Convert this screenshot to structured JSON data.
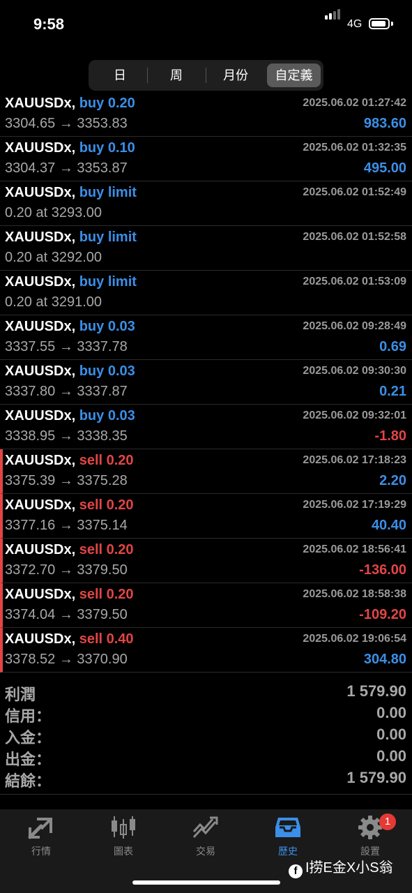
{
  "status": {
    "time": "9:58",
    "network": "4G",
    "battery_level": 0.9
  },
  "segments": [
    {
      "label": "日",
      "active": false
    },
    {
      "label": "周",
      "active": false
    },
    {
      "label": "月份",
      "active": false
    },
    {
      "label": "自定義",
      "active": true
    }
  ],
  "trades": [
    {
      "symbol": "XAUUSDx,",
      "op": "buy 0.20",
      "side": "buy",
      "time": "2025.06.02 01:27:42",
      "prices": "3304.65 → 3353.83",
      "profit": "983.60"
    },
    {
      "symbol": "XAUUSDx,",
      "op": "buy 0.10",
      "side": "buy",
      "time": "2025.06.02 01:32:35",
      "prices": "3304.37 → 3353.87",
      "profit": "495.00"
    },
    {
      "symbol": "XAUUSDx,",
      "op": "buy limit",
      "side": "buy",
      "time": "2025.06.02 01:52:49",
      "prices": "0.20 at 3293.00",
      "profit": ""
    },
    {
      "symbol": "XAUUSDx,",
      "op": "buy limit",
      "side": "buy",
      "time": "2025.06.02 01:52:58",
      "prices": "0.20 at 3292.00",
      "profit": ""
    },
    {
      "symbol": "XAUUSDx,",
      "op": "buy limit",
      "side": "buy",
      "time": "2025.06.02 01:53:09",
      "prices": "0.20 at 3291.00",
      "profit": ""
    },
    {
      "symbol": "XAUUSDx,",
      "op": "buy 0.03",
      "side": "buy",
      "time": "2025.06.02 09:28:49",
      "prices": "3337.55 → 3337.78",
      "profit": "0.69"
    },
    {
      "symbol": "XAUUSDx,",
      "op": "buy 0.03",
      "side": "buy",
      "time": "2025.06.02 09:30:30",
      "prices": "3337.80 → 3337.87",
      "profit": "0.21"
    },
    {
      "symbol": "XAUUSDx,",
      "op": "buy 0.03",
      "side": "buy",
      "time": "2025.06.02 09:32:01",
      "prices": "3338.95 → 3338.35",
      "profit": "-1.80"
    },
    {
      "symbol": "XAUUSDx,",
      "op": "sell 0.20",
      "side": "sell",
      "time": "2025.06.02 17:18:23",
      "prices": "3375.39 → 3375.28",
      "profit": "2.20"
    },
    {
      "symbol": "XAUUSDx,",
      "op": "sell 0.20",
      "side": "sell",
      "time": "2025.06.02 17:19:29",
      "prices": "3377.16 → 3375.14",
      "profit": "40.40"
    },
    {
      "symbol": "XAUUSDx,",
      "op": "sell 0.20",
      "side": "sell",
      "time": "2025.06.02 18:56:41",
      "prices": "3372.70 → 3379.50",
      "profit": "-136.00"
    },
    {
      "symbol": "XAUUSDx,",
      "op": "sell 0.20",
      "side": "sell",
      "time": "2025.06.02 18:58:38",
      "prices": "3374.04 → 3379.50",
      "profit": "-109.20"
    },
    {
      "symbol": "XAUUSDx,",
      "op": "sell 0.40",
      "side": "sell",
      "time": "2025.06.02 19:06:54",
      "prices": "3378.52 → 3370.90",
      "profit": "304.80"
    }
  ],
  "summary": [
    {
      "label": "利潤",
      "value": "1 579.90"
    },
    {
      "label": "信用：",
      "value": "0.00"
    },
    {
      "label": "入金：",
      "value": "0.00"
    },
    {
      "label": "出金：",
      "value": "0.00"
    },
    {
      "label": "結餘：",
      "value": "1 579.90"
    }
  ],
  "tabs": [
    {
      "label": "行情",
      "icon": "arrows-icon",
      "active": false
    },
    {
      "label": "圖表",
      "icon": "candlestick-icon",
      "active": false
    },
    {
      "label": "交易",
      "icon": "trade-chart-icon",
      "active": false
    },
    {
      "label": "歷史",
      "icon": "inbox-tray-icon",
      "active": true
    },
    {
      "label": "設置",
      "icon": "gear-icon",
      "active": false
    }
  ],
  "settings_badge": "1",
  "watermark": {
    "icon": "facebook-icon",
    "text": "I捞E金X小S翁"
  },
  "colors": {
    "buy": "#3b8fe8",
    "sell": "#e24545",
    "active_tab": "#3b8fe8",
    "inactive_tab": "#8a8a8a"
  }
}
